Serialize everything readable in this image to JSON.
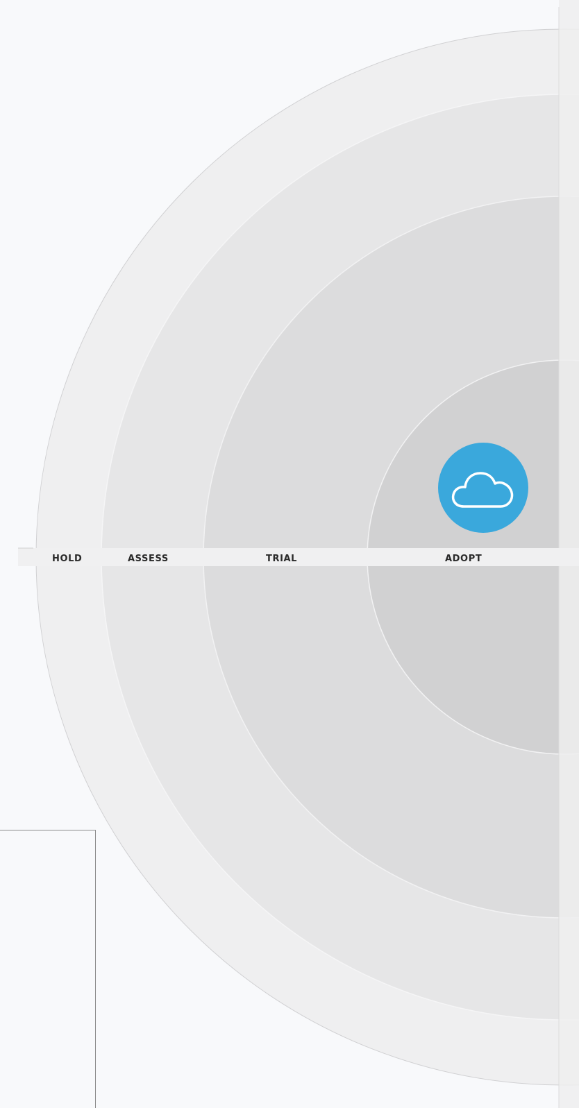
{
  "radar": {
    "rings": [
      {
        "key": "hold",
        "label": "HOLD",
        "color": "#efeff0"
      },
      {
        "key": "assess",
        "label": "ASSESS",
        "color": "#e6e6e7"
      },
      {
        "key": "trial",
        "label": "TRIAL",
        "color": "#dcdcdd"
      },
      {
        "key": "adopt",
        "label": "ADOPT",
        "color": "#d1d1d2"
      }
    ],
    "label_band_color": "#f0f0f1"
  },
  "blip": {
    "icon": "cloud-icon",
    "color": "#3aa8dc"
  }
}
